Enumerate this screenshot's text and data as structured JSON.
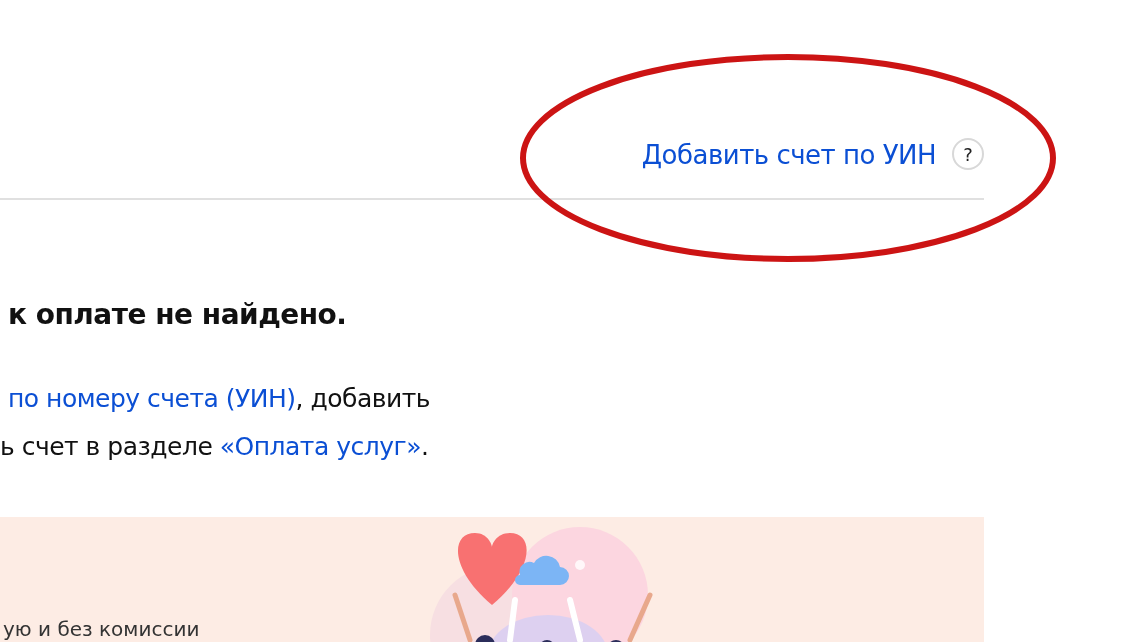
{
  "header": {
    "link": "Добавить счет по УИН",
    "help": "?"
  },
  "notice": {
    "title": "к оплате не найдено.",
    "lines": [
      [
        {
          "text": "по номеру счета (УИН)",
          "link": true
        },
        {
          "text": ", добавить",
          "link": false
        }
      ],
      [
        {
          "text": "ь счет в разделе ",
          "link": false
        },
        {
          "text": "«Оплата услуг»",
          "link": true
        },
        {
          "text": ".",
          "link": false
        }
      ]
    ]
  },
  "banner": {
    "text": "ую и без комиссии"
  },
  "annotation": {
    "kind": "ellipse"
  }
}
